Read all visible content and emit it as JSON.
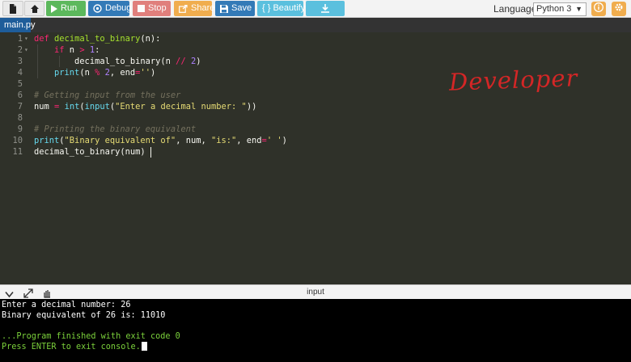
{
  "toolbar": {
    "run_label": "Run",
    "debug_label": "Debug",
    "stop_label": "Stop",
    "share_label": "Share",
    "save_label": "Save",
    "beautify_label": "{ } Beautify",
    "language_label": "Language",
    "language_value": "Python 3"
  },
  "tabs": [
    {
      "label": "main.py"
    }
  ],
  "editor": {
    "lines": [
      {
        "n": "1",
        "code": "def decimal_to_binary(n):"
      },
      {
        "n": "2",
        "code": "    if n > 1:"
      },
      {
        "n": "3",
        "code": "        decimal_to_binary(n // 2)"
      },
      {
        "n": "4",
        "code": "    print(n % 2, end='')"
      },
      {
        "n": "5",
        "code": ""
      },
      {
        "n": "6",
        "code": "# Getting input from the user"
      },
      {
        "n": "7",
        "code": "num = int(input(\"Enter a decimal number: \"))"
      },
      {
        "n": "8",
        "code": ""
      },
      {
        "n": "9",
        "code": "# Printing the binary equivalent"
      },
      {
        "n": "10",
        "code": "print(\"Binary equivalent of\", num, \"is:\", end=' ')"
      },
      {
        "n": "11",
        "code": "decimal_to_binary(num)"
      }
    ],
    "watermark": "Developer"
  },
  "console": {
    "title": "input",
    "output": [
      "Enter a decimal number: 26",
      "Binary equivalent of 26 is: 11010",
      "",
      "...Program finished with exit code 0",
      "Press ENTER to exit console."
    ]
  },
  "colors": {
    "run": "#5cb85c",
    "debug": "#337ab7",
    "stop": "#d9534f",
    "share": "#f0ad4e",
    "save": "#337ab7",
    "beautify": "#5bc0de",
    "editor_bg": "#2f3129",
    "console_bg": "#000000",
    "console_status": "#7bd13b",
    "tab_active": "#1e5d9a"
  },
  "icons": [
    "file-icon",
    "tools-icon",
    "play-icon",
    "debug-icon",
    "stop-icon",
    "share-icon",
    "save-icon",
    "download-icon",
    "info-icon",
    "gear-icon",
    "collapse-icon",
    "expand-icon",
    "drag-icon"
  ]
}
